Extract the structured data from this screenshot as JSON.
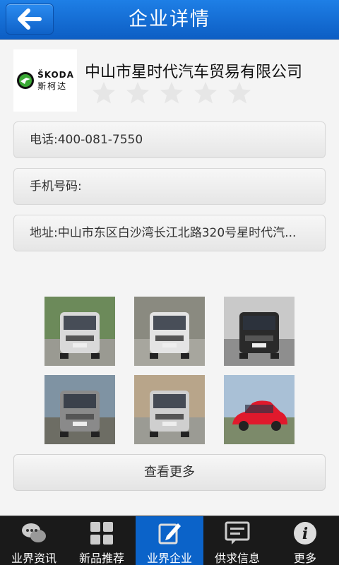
{
  "header": {
    "title": "企业详情"
  },
  "company": {
    "logo_brand": "ŠKODA",
    "logo_cn": "斯柯达",
    "name": "中山市星时代汽车贸易有限公司",
    "rating": 0,
    "rating_max": 5
  },
  "info": {
    "phone": "电话:400-081-7550",
    "mobile": "手机号码:",
    "address": "地址:中山市东区白沙湾长江北路320号星时代汽..."
  },
  "photos": [
    {
      "car_color": "#d9d9d9"
    },
    {
      "car_color": "#e4e4e4"
    },
    {
      "car_color": "#2a2a2a"
    },
    {
      "car_color": "#8a8a8a"
    },
    {
      "car_color": "#cfcfcf"
    },
    {
      "car_color": "#e0192c"
    }
  ],
  "more_button": "查看更多",
  "tabs": [
    {
      "label": "业界资讯",
      "icon": "chat-bubbles-icon",
      "active": false
    },
    {
      "label": "新品推荐",
      "icon": "grid-icon",
      "active": false
    },
    {
      "label": "业界企业",
      "icon": "edit-icon",
      "active": true
    },
    {
      "label": "供求信息",
      "icon": "message-icon",
      "active": false
    },
    {
      "label": "更多",
      "icon": "info-icon",
      "active": false
    }
  ],
  "colors": {
    "header_blue": "#0d5ec4",
    "tab_active": "#0b63c9",
    "tab_bg": "#1a1a1a"
  }
}
